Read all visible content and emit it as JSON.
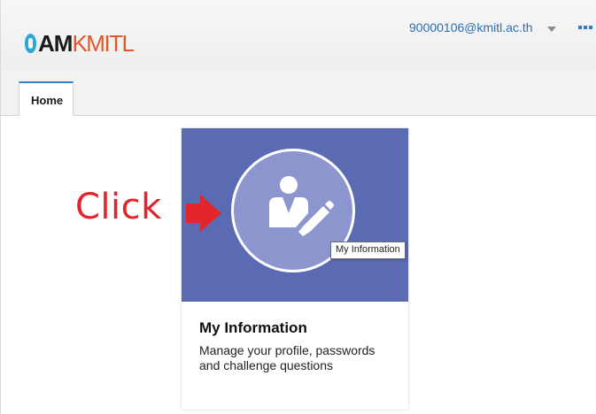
{
  "app": {
    "logo_text_1": "AM",
    "logo_text_2": "KMITL"
  },
  "header": {
    "user_email": "90000106@kmitl.ac.th",
    "icons": [
      "chevron-down-icon",
      "more-icon"
    ]
  },
  "tabs": [
    {
      "label": "Home",
      "active": true
    }
  ],
  "tile": {
    "title": "My Information",
    "description": "Manage your profile, passwords and challenge questions",
    "icon": "user-edit-icon",
    "tooltip": "My Information"
  },
  "annotation": {
    "label": "Click",
    "icon": "arrow-right-icon"
  },
  "colors": {
    "accent": "#3b7ec7",
    "tile_bg": "#5b6bb3",
    "tile_circle": "#8c95cd",
    "annotation": "#e2252b",
    "logo_blue": "#2aa6d9",
    "logo_orange": "#e0592a"
  }
}
